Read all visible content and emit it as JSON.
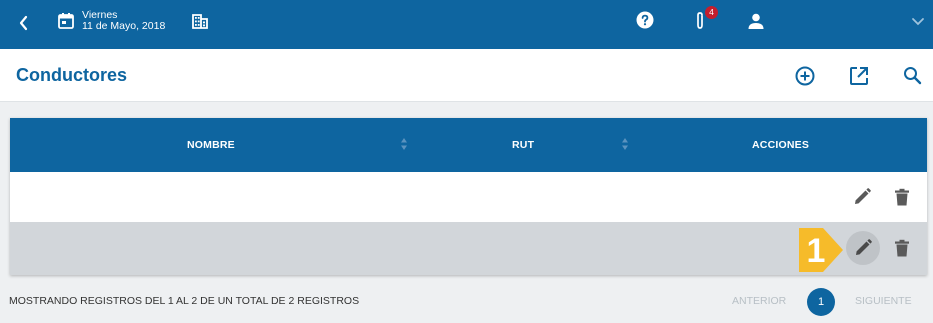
{
  "topbar": {
    "date_day": "Viernes",
    "date_full": "11 de Mayo, 2018",
    "notification_count": "4",
    "color": "#0e65a0"
  },
  "page": {
    "title": "Conductores"
  },
  "table": {
    "columns": [
      "NOMBRE",
      "RUT",
      "ACCIONES"
    ],
    "rows": [
      {
        "nombre": "",
        "rut": ""
      },
      {
        "nombre": "",
        "rut": ""
      }
    ]
  },
  "annotation": {
    "step_number": "1"
  },
  "footer": {
    "summary": "MOSTRANDO REGISTROS DEL 1 AL 2 DE UN TOTAL DE 2 REGISTROS",
    "prev_label": "ANTERIOR",
    "current_page": "1",
    "next_label": "SIGUIENTE"
  },
  "icons": {
    "back": "chevron-left-icon",
    "calendar": "calendar-icon",
    "building": "building-icon",
    "help": "help-icon",
    "attachment": "paperclip-icon",
    "user": "user-icon",
    "menu": "chevron-down-icon",
    "add": "add-circle-icon",
    "export": "open-in-new-icon",
    "search": "search-icon",
    "edit": "pencil-icon",
    "delete": "trash-icon"
  }
}
